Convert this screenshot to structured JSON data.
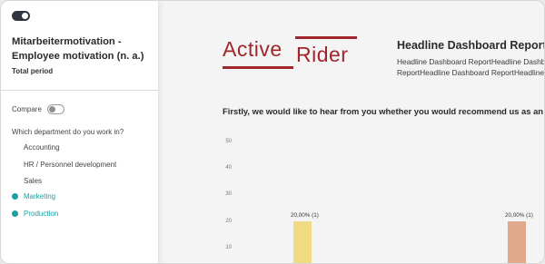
{
  "sidebar": {
    "title": "Mitarbeitermotivation - Employee motivation (n. a.)",
    "period": "Total period",
    "compare_label": "Compare",
    "department_question": "Which department do you work in?",
    "departments": [
      {
        "label": "Accounting",
        "selected": false
      },
      {
        "label": "HR / Personnel development",
        "selected": false
      },
      {
        "label": "Sales",
        "selected": false
      },
      {
        "label": "Marketing",
        "selected": true
      },
      {
        "label": "Production",
        "selected": true
      }
    ]
  },
  "header": {
    "logo_word1": "Active",
    "logo_word2": "Rider",
    "title": "Headline Dashboard Report",
    "subtitle_line1": "Headline Dashboard ReportHeadline Dashbo",
    "subtitle_line2": "ReportHeadline Dashboard ReportHeadline"
  },
  "question": "Firstly, we would like to hear from you whether you would recommend us as an em",
  "colors": {
    "brand": "#a0262b",
    "accent": "#1aa0a0",
    "bar1": "#f0da84",
    "bar2": "#e0a98b"
  },
  "chart_data": {
    "type": "bar",
    "y_ticks": [
      "50",
      "40",
      "30",
      "20",
      "10"
    ],
    "ylim": [
      0,
      55
    ],
    "bars": [
      {
        "value": 20,
        "label": "20,00% (1)",
        "color": "#f0da84"
      },
      {
        "value": 20,
        "label": "20,00% (1)",
        "color": "#e0a98b"
      }
    ]
  }
}
